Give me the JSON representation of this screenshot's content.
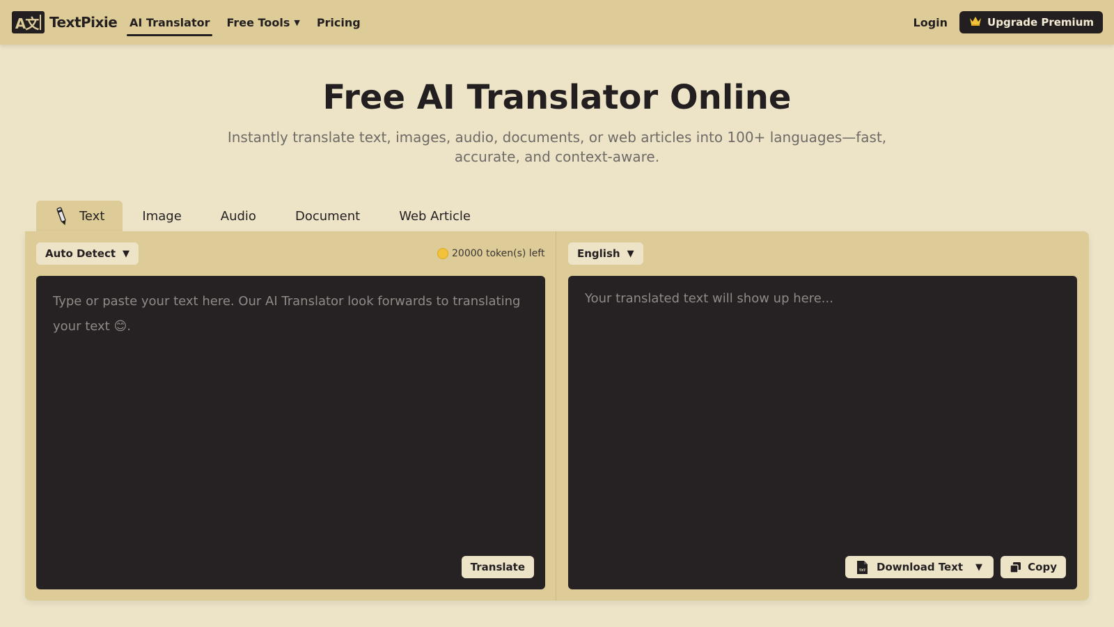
{
  "brand": {
    "mark": "A文",
    "name": "TextPixie"
  },
  "nav": {
    "items": [
      {
        "label": "AI Translator",
        "active": true
      },
      {
        "label": "Free Tools",
        "has_dropdown": true
      },
      {
        "label": "Pricing"
      }
    ],
    "login": "Login",
    "upgrade": "Upgrade Premium",
    "upgrade_icon": "crown-icon"
  },
  "hero": {
    "title": "Free AI Translator Online",
    "subtitle": "Instantly translate text, images, audio, documents, or web articles into 100+ languages—fast, accurate, and context-aware."
  },
  "tabs": [
    {
      "label": "Text",
      "active": true,
      "icon": "pen-icon"
    },
    {
      "label": "Image"
    },
    {
      "label": "Audio"
    },
    {
      "label": "Document"
    },
    {
      "label": "Web Article"
    }
  ],
  "source": {
    "language": "Auto Detect",
    "tokens": "20000 token(s) left",
    "placeholder": "Type or paste your text here. Our AI Translator look forwards to translating your text 😊.",
    "translate": "Translate"
  },
  "target": {
    "language": "English",
    "placeholder": "Your translated text will show up here...",
    "download": "Download Text",
    "copy": "Copy"
  },
  "colors": {
    "header_bg": "#decc98",
    "page_bg": "#ede4c8",
    "dark": "#231f20",
    "text_box": "#262224",
    "coin": "#f2c23b"
  }
}
